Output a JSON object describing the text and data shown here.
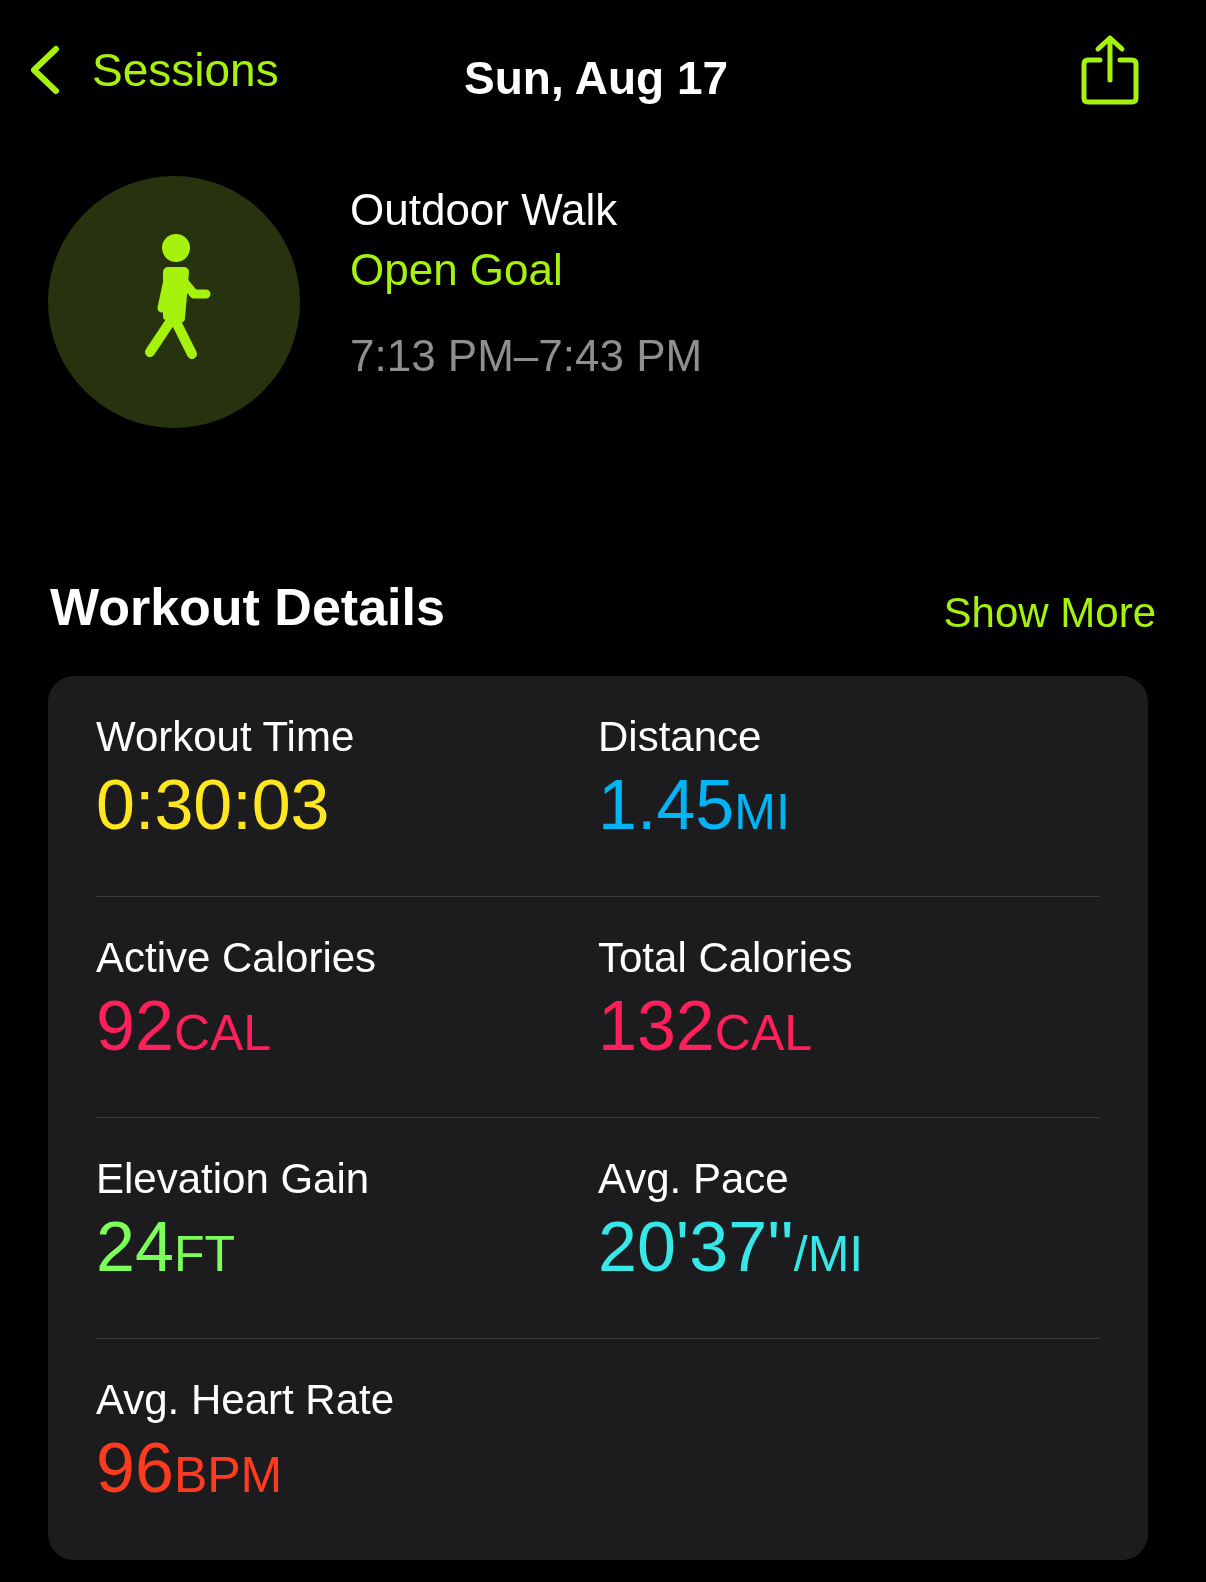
{
  "nav": {
    "back_label": "Sessions",
    "title": "Sun, Aug 17"
  },
  "workout": {
    "name": "Outdoor Walk",
    "goal": "Open Goal",
    "time_range": "7:13 PM–7:43 PM"
  },
  "section": {
    "title": "Workout Details",
    "action": "Show More"
  },
  "metrics": [
    {
      "label": "Workout Time",
      "value": "0:30:03",
      "color": "#ffe620"
    },
    {
      "label": "Distance",
      "value": "1.45",
      "unit": "MI",
      "color": "#00b4f5"
    },
    {
      "label": "Active Calories",
      "value": "92",
      "unit": "CAL",
      "color": "#ff1f5a"
    },
    {
      "label": "Total Calories",
      "value": "132",
      "unit": "CAL",
      "color": "#ff1f5a"
    },
    {
      "label": "Elevation Gain",
      "value": "24",
      "unit": "FT",
      "color": "#7dff5a"
    },
    {
      "label": "Avg. Pace",
      "value": "20'37''",
      "unit": "/MI",
      "color": "#37e6e6"
    },
    {
      "label": "Avg. Heart Rate",
      "value": "96",
      "unit": "BPM",
      "color": "#ff3b1f"
    }
  ]
}
